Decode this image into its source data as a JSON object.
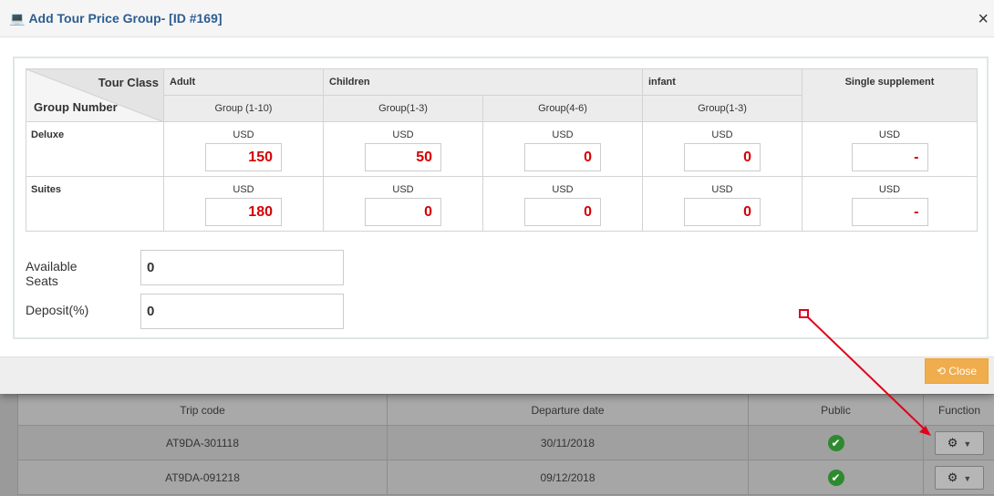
{
  "modal": {
    "title": "Add Tour Price Group- [ID #169]",
    "close_x": "×",
    "corner": {
      "tour_class": "Tour Class",
      "group_number": "Group Number"
    },
    "classes": {
      "adult": "Adult",
      "children": "Children",
      "infant": "infant",
      "single": "Single supplement"
    },
    "groups": [
      "Group (1-10)",
      "Group(1-3)",
      "Group(4-6)",
      "Group(1-3)"
    ],
    "rows": [
      {
        "name": "Deluxe",
        "currency": "USD",
        "values": [
          "150",
          "50",
          "0",
          "0",
          "-"
        ]
      },
      {
        "name": "Suites",
        "currency": "USD",
        "values": [
          "180",
          "0",
          "0",
          "0",
          "-"
        ]
      }
    ],
    "available_seats": {
      "label": "Available Seats",
      "value": "0"
    },
    "deposit": {
      "label": "Deposit(%)",
      "value": "0"
    },
    "close_button": "Close"
  },
  "background_table": {
    "headers": [
      "Trip code",
      "Departure date",
      "Public",
      "Function"
    ],
    "rows": [
      {
        "trip_code": "AT9DA-301118",
        "departure": "30/11/2018",
        "public": "check-icon"
      },
      {
        "trip_code": "AT9DA-091218",
        "departure": "09/12/2018",
        "public": "check-icon"
      }
    ]
  },
  "colors": {
    "title": "#2c5d90",
    "price": "#d40000",
    "close_button": "#f0ad4e",
    "annotation": "#e0001b"
  }
}
